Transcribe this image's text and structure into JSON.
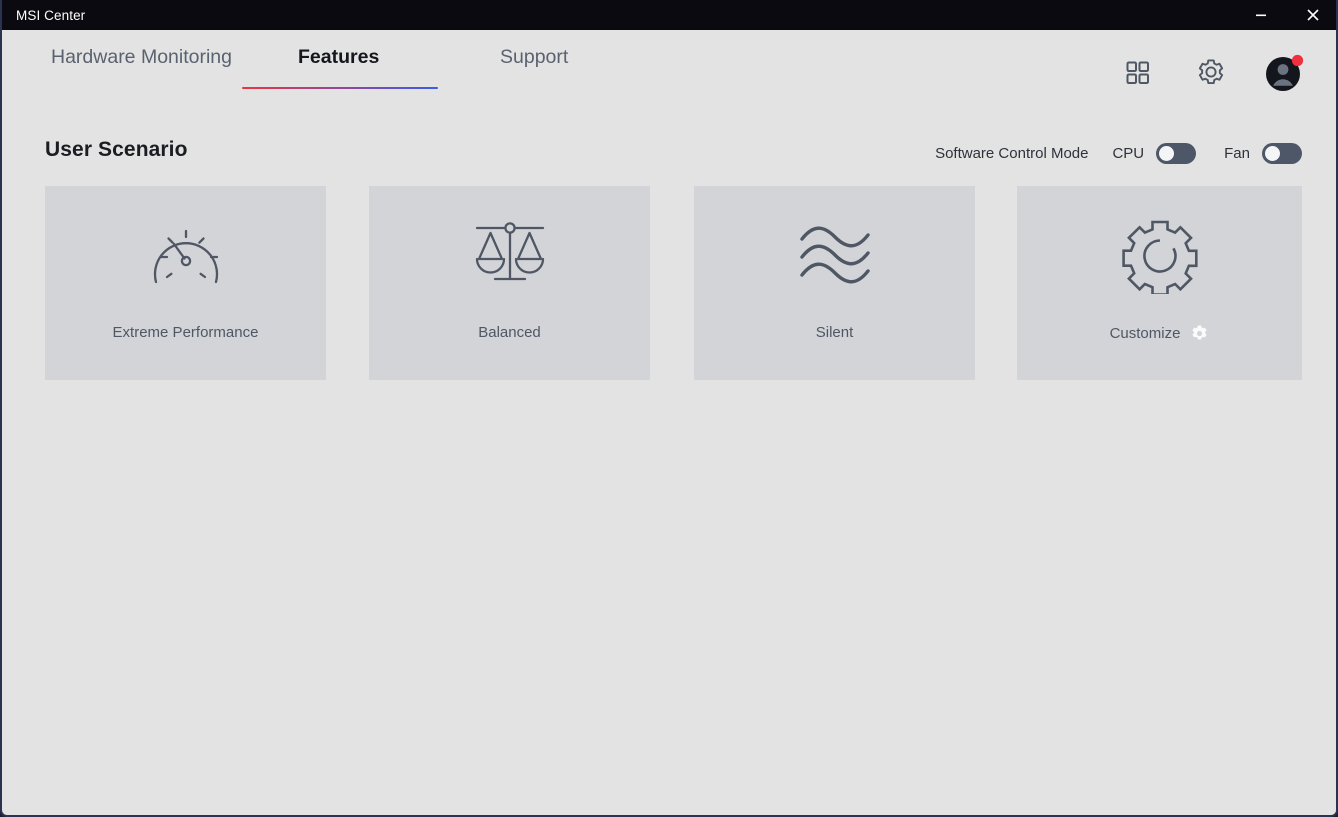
{
  "window": {
    "title": "MSI Center",
    "minimize_label": "Minimize",
    "close_label": "Close"
  },
  "nav": {
    "tabs": [
      {
        "label": "Hardware Monitoring",
        "active": false
      },
      {
        "label": "Features",
        "active": true
      },
      {
        "label": "Support",
        "active": false
      }
    ],
    "active_underline_gradient_from": "#ed3340",
    "active_underline_gradient_to": "#3a5bf0",
    "icons": [
      {
        "name": "grid-icon",
        "label": "Apps"
      },
      {
        "name": "gear-icon",
        "label": "Settings"
      },
      {
        "name": "avatar-icon",
        "label": "Profile",
        "badge": true,
        "badge_color": "#f0303c"
      }
    ]
  },
  "section": {
    "title": "User Scenario",
    "software_control_mode_label": "Software Control Mode",
    "toggles": [
      {
        "label": "CPU",
        "on": false
      },
      {
        "label": "Fan",
        "on": false
      }
    ]
  },
  "cards": [
    {
      "label": "Extreme Performance",
      "icon": "speedometer-icon",
      "has_settings_gear": false
    },
    {
      "label": "Balanced",
      "icon": "scales-icon",
      "has_settings_gear": false
    },
    {
      "label": "Silent",
      "icon": "waves-icon",
      "has_settings_gear": false
    },
    {
      "label": "Customize",
      "icon": "gear-large-icon",
      "has_settings_gear": true
    }
  ],
  "colors": {
    "window_background": "#e3e3e3",
    "titlebar_background": "#0a0a10",
    "card_background": "#d3d4d8",
    "icon_stroke": "#4f5764",
    "toggle_track": "#4e5768",
    "toggle_knob": "#f4f5f6"
  }
}
